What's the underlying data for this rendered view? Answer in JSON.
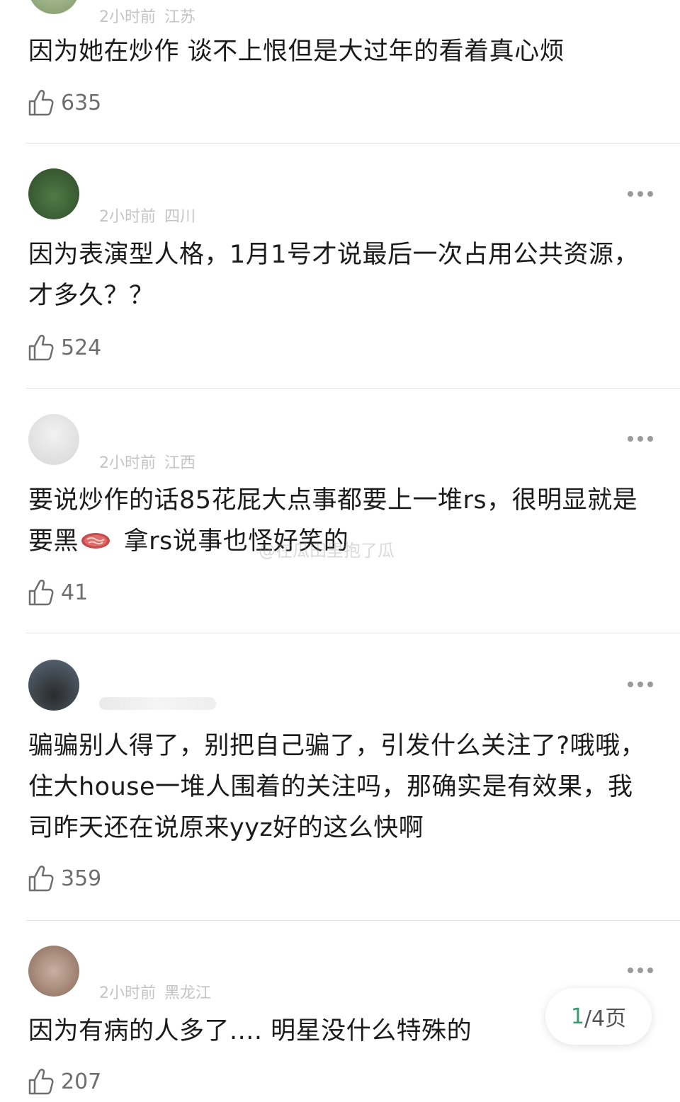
{
  "comments": [
    {
      "time": "2小时前",
      "location": "江苏",
      "text": "因为她在炒作  谈不上恨但是大过年的看着真心烦",
      "likes": "635"
    },
    {
      "time": "2小时前",
      "location": "四川",
      "text": "因为表演型人格，1月1号才说最后一次占用公共资源，才多久？？",
      "likes": "524"
    },
    {
      "time": "2小时前",
      "location": "江西",
      "text_part1": "要说炒作的话85花屁大点事都要上一堆rs，很明显就是要黑",
      "text_part2": " 拿rs说事也怪好笑的",
      "emoji": "steak-emoji",
      "likes": "41"
    },
    {
      "time": "",
      "location": "",
      "text": "骗骗别人得了，别把自己骗了，引发什么关注了?哦哦，住大house一堆人围着的关注吗，那确实是有效果，我司昨天还在说原来yyz好的这么快啊",
      "likes": "359"
    },
    {
      "time": "2小时前",
      "location": "黑龙江",
      "text": "因为有病的人多了....   明星没什么特殊的",
      "likes": "207"
    }
  ],
  "watermark": "@在瓜田里抱了瓜",
  "pager": {
    "current": "1",
    "total": "/4页"
  },
  "icons": {
    "like": "thumbs-up-icon",
    "more": "more-dots-icon"
  },
  "colors": {
    "accent": "#3a9a6e",
    "meta": "#c4c4c4",
    "divider": "#e6e6e6"
  }
}
